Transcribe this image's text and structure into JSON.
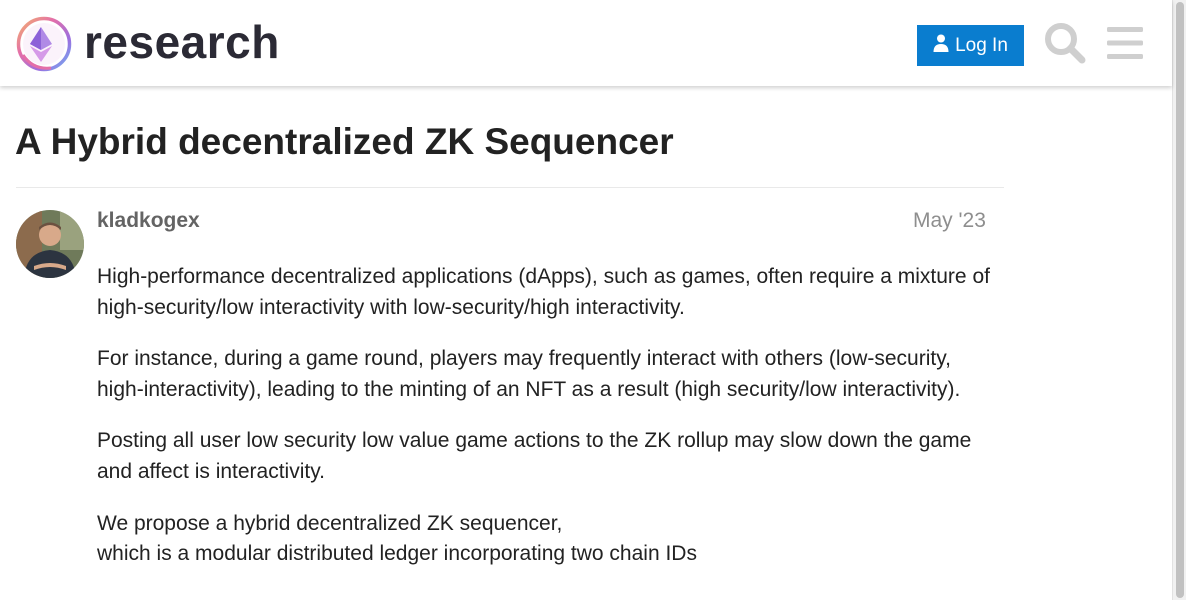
{
  "header": {
    "brand": "research",
    "login_label": "Log In"
  },
  "topic": {
    "title": "A Hybrid decentralized ZK Sequencer"
  },
  "post": {
    "username": "kladkogex",
    "date": "May '23",
    "paragraphs": [
      "High-performance decentralized applications (dApps), such as games, often require a mixture of high-security/low interactivity with low-security/high interactivity.",
      "For instance, during a game round, players may frequently interact with others (low-security, high-interactivity), leading to the minting of an NFT as a result (high security/low interactivity).",
      "Posting all user low security low value game actions to the ZK rollup may slow down the game and affect is interactivity."
    ],
    "last_paragraph_lines": [
      "We propose a hybrid decentralized ZK sequencer,",
      "which is a modular distributed ledger incorporating two chain IDs"
    ]
  },
  "colors": {
    "accent": "#0a7dcf",
    "brand_text": "#2b2a35",
    "icon_gray": "#cfcfcf"
  },
  "icons": [
    "user-icon",
    "search-icon",
    "hamburger-menu-icon",
    "logo-icon"
  ]
}
